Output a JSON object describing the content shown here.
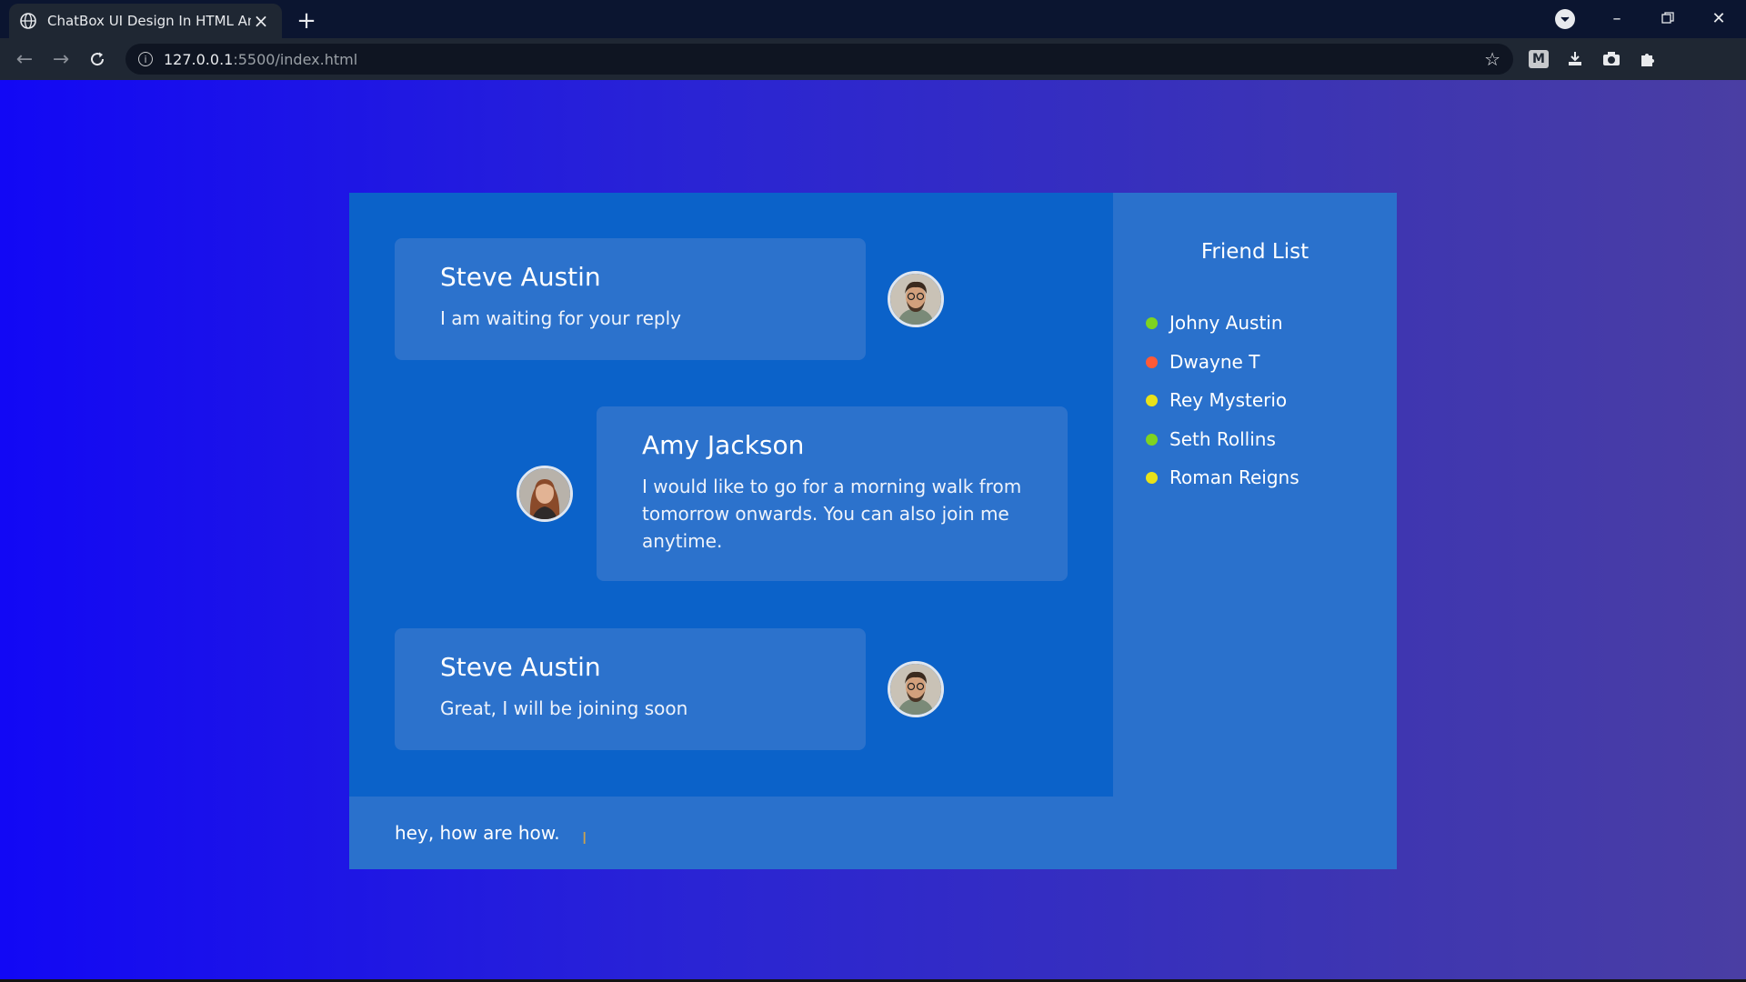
{
  "browser": {
    "tab_title": "ChatBox UI Design In HTML And",
    "url_host": "127.0.0.1",
    "url_rest": ":5500/index.html",
    "icons": [
      "globe-icon",
      "close-icon",
      "plus-icon",
      "back-icon",
      "forward-icon",
      "reload-icon",
      "info-icon",
      "star-icon",
      "puzzle-icon",
      "camera-icon",
      "download-icon",
      "profile-icon",
      "kebab-icon"
    ]
  },
  "messages": [
    {
      "sender": "Steve Austin",
      "text": "I am waiting for your reply"
    },
    {
      "sender": "Amy Jackson",
      "text": "I would like to go for a morning walk from tomorrow onwards. You can also join me anytime."
    },
    {
      "sender": "Steve Austin",
      "text": "Great, I will be joining soon"
    }
  ],
  "friend_list": {
    "title": "Friend List",
    "friends": [
      {
        "name": "Johny Austin",
        "status_color": "#7ed321"
      },
      {
        "name": "Dwayne T",
        "status_color": "#ff5a36"
      },
      {
        "name": "Rey Mysterio",
        "status_color": "#e8e21a"
      },
      {
        "name": "Seth Rollins",
        "status_color": "#7ed321"
      },
      {
        "name": "Roman Reigns",
        "status_color": "#e8e21a"
      }
    ]
  },
  "composer": {
    "value": "hey, how are how."
  },
  "colors": {
    "message_panel": "#0b62c9",
    "bubble": "#2c72cc",
    "sidebar": "#2a71cc"
  }
}
